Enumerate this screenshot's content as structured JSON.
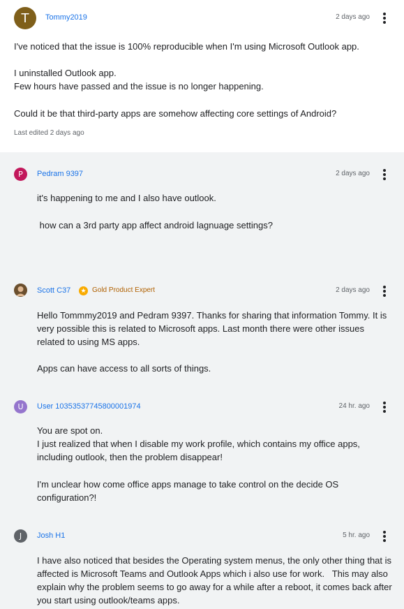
{
  "original_post": {
    "author": "Tommy2019",
    "avatar_letter": "T",
    "avatar_color": "#7f5f1a",
    "time": "2 days ago",
    "body_1": "I've noticed that the issue is 100% reproducible when I'm using Microsoft Outlook app.",
    "body_2": "I uninstalled Outlook app.\nFew hours have passed and the issue is no longer happening.",
    "body_3": "Could it be that third-party apps are somehow affecting core settings of Android?",
    "edited": "Last edited 2 days ago"
  },
  "replies": [
    {
      "author": "Pedram 9397",
      "avatar_letter": "P",
      "avatar_color": "#c2185b",
      "time": "2 days ago",
      "body_1": "it's happening to me and I also have outlook.",
      "body_2": " how can a 3rd party app affect android lagnuage settings?"
    },
    {
      "author": "Scott C37",
      "avatar_icon": "photo-avatar",
      "badge": "Gold Product Expert",
      "badge_color": "#f9ab00",
      "time": "2 days ago",
      "body_1": "Hello Tommmy2019 and Pedram 9397. Thanks for sharing that information Tommy. It is very possible this is related to Microsoft apps. Last month there were other issues related to using MS apps.",
      "body_2": "Apps can have access to all sorts of things."
    },
    {
      "author": "User 10353537745800001974",
      "avatar_letter": "U",
      "avatar_color": "#9575cd",
      "time": "24 hr. ago",
      "body_1": "You are spot on.\nI just realized that when I disable my work profile, which contains my office apps, including outlook, then the problem disappear!",
      "body_2": "I'm unclear how come office apps manage to take control on the decide OS configuration?!"
    },
    {
      "author": "Josh H1",
      "avatar_letter": "J",
      "avatar_color": "#5f6368",
      "time": "5 hr. ago",
      "body_1": "I have also noticed that besides the Operating system menus, the only other thing that is affected is Microsoft Teams and Outlook Apps which i also use for work.   This may also explain why the problem seems to go away for a while after a reboot, it comes back after you start using outlook/teams apps."
    }
  ]
}
